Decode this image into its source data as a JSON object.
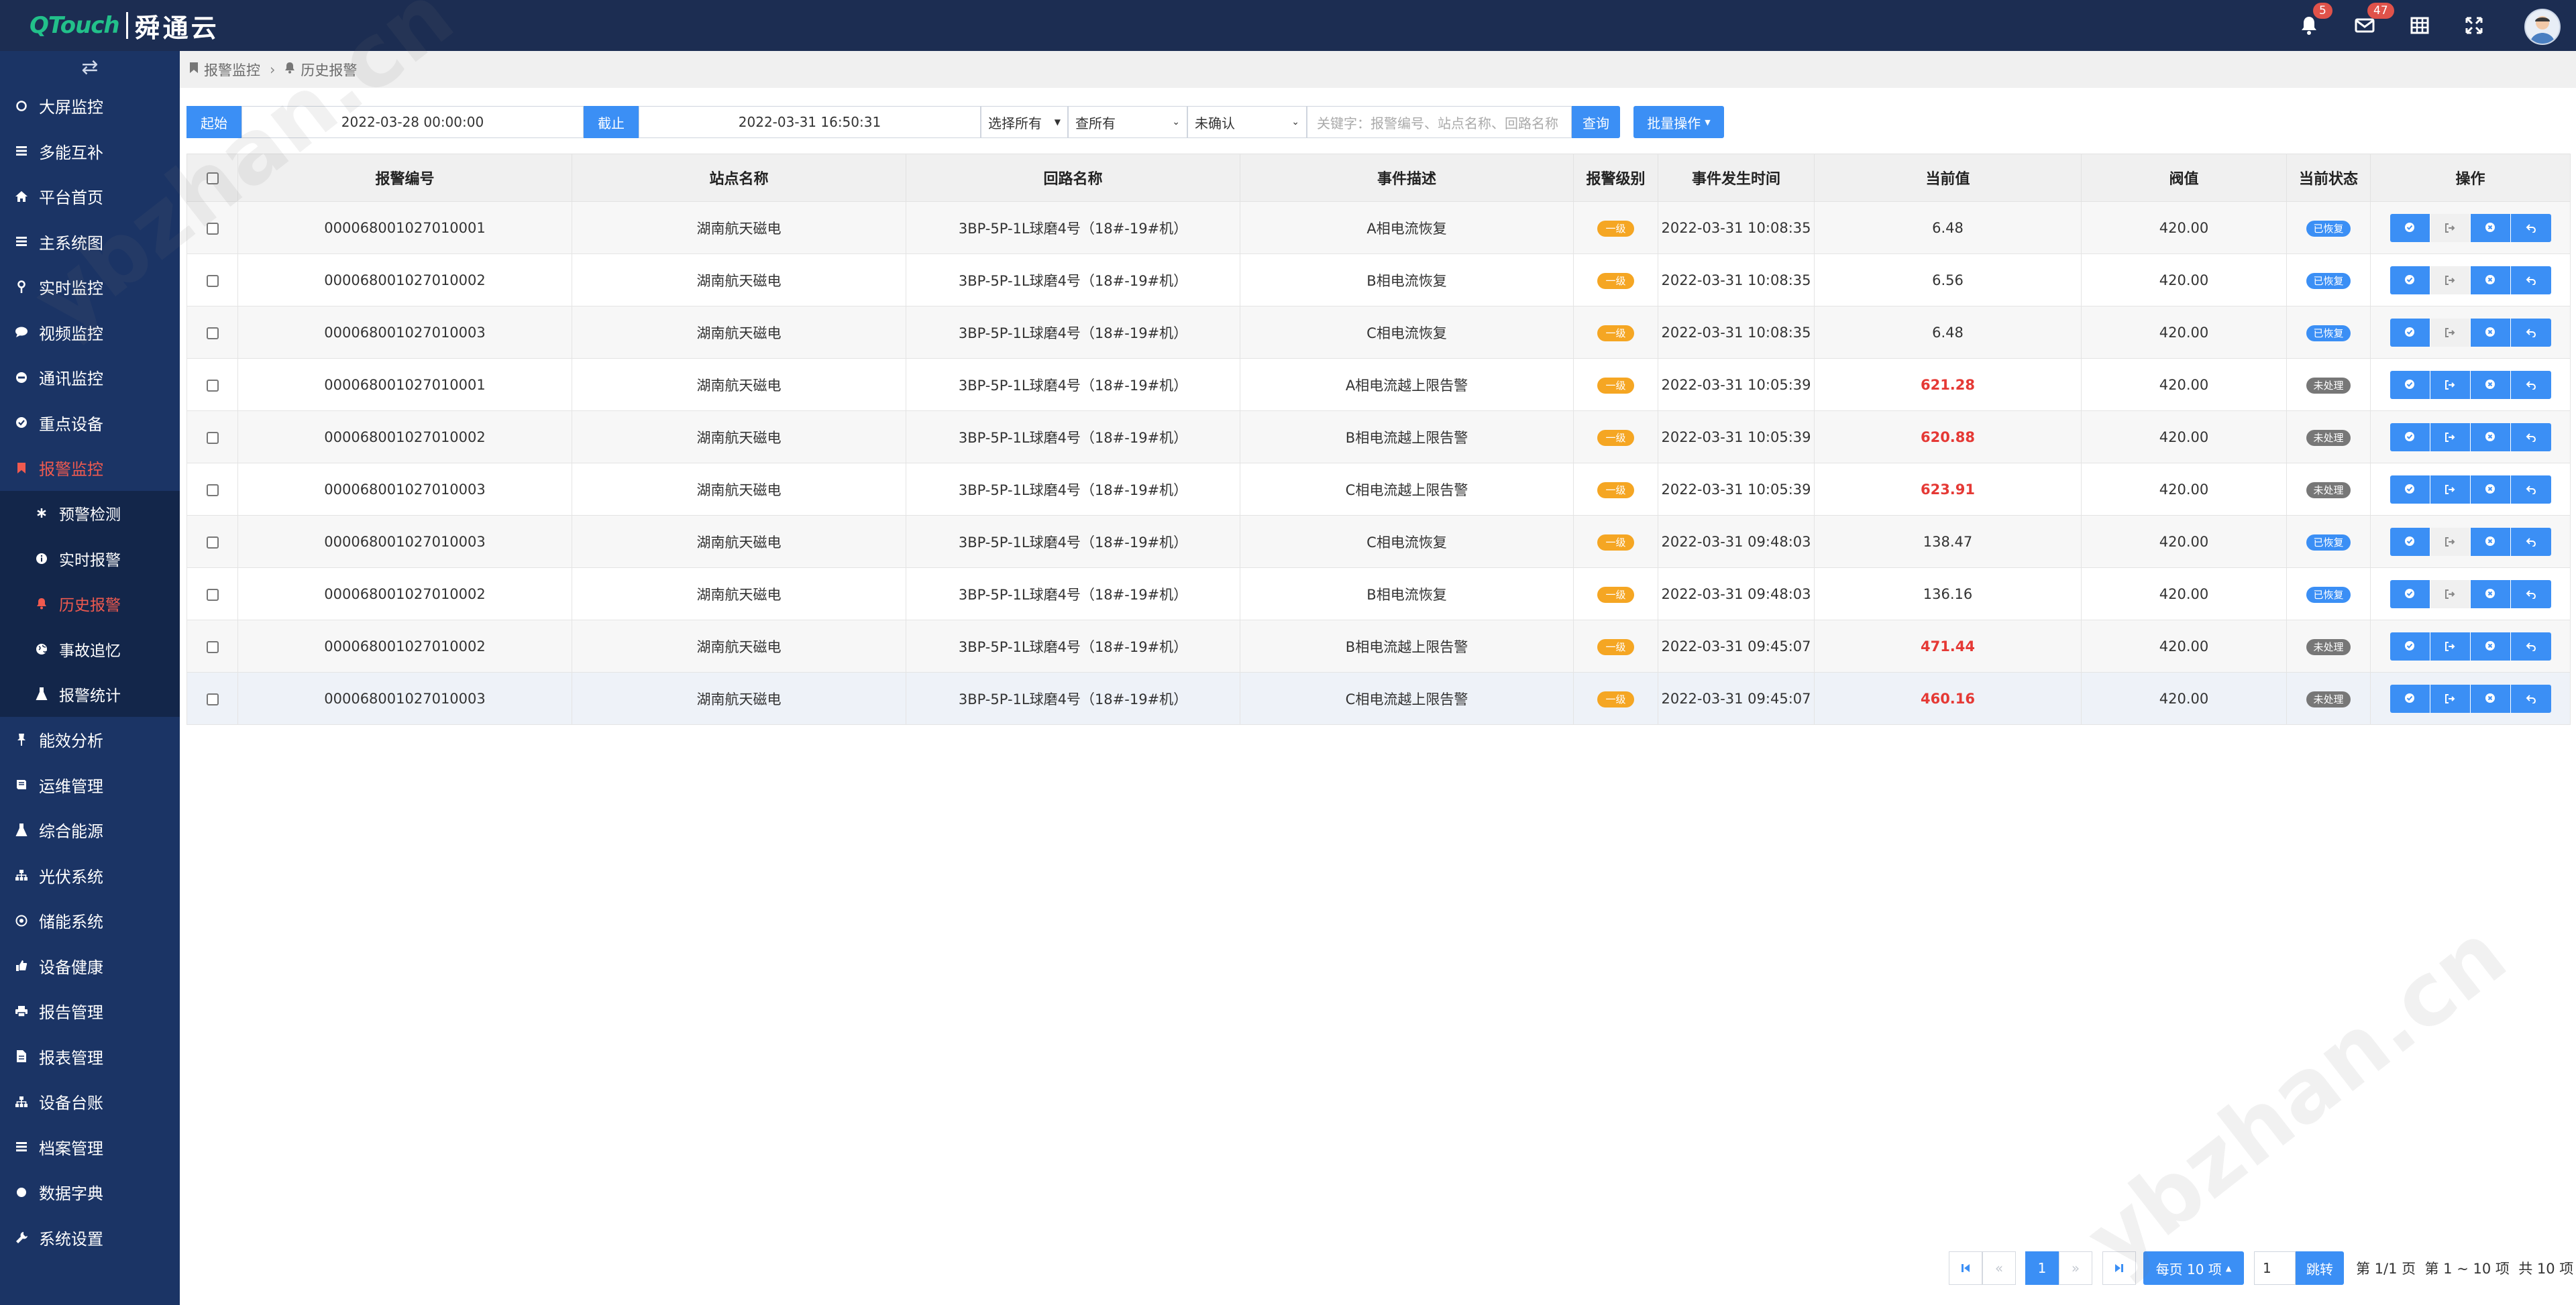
{
  "brand": {
    "logo_en": "QTouch",
    "logo_cn": "舜通云"
  },
  "topbar": {
    "notifications_badge": "5",
    "messages_badge": "47"
  },
  "sidebar": {
    "items": [
      {
        "label": "大屏监控",
        "icon": "circle-outline-icon"
      },
      {
        "label": "多能互补",
        "icon": "list-icon"
      },
      {
        "label": "平台首页",
        "icon": "home-icon"
      },
      {
        "label": "主系统图",
        "icon": "list-icon"
      },
      {
        "label": "实时监控",
        "icon": "map-pin-icon"
      },
      {
        "label": "视频监控",
        "icon": "chat-icon"
      },
      {
        "label": "通讯监控",
        "icon": "no-entry-icon"
      },
      {
        "label": "重点设备",
        "icon": "check-circle-icon"
      },
      {
        "label": "报警监控",
        "icon": "bookmark-icon"
      },
      {
        "label": "能效分析",
        "icon": "pushpin-icon"
      },
      {
        "label": "运维管理",
        "icon": "book-icon"
      },
      {
        "label": "综合能源",
        "icon": "flask-icon"
      },
      {
        "label": "光伏系统",
        "icon": "sitemap-icon"
      },
      {
        "label": "储能系统",
        "icon": "target-icon"
      },
      {
        "label": "设备健康",
        "icon": "thumbs-up-icon"
      },
      {
        "label": "报告管理",
        "icon": "printer-icon"
      },
      {
        "label": "报表管理",
        "icon": "file-icon"
      },
      {
        "label": "设备台账",
        "icon": "sitemap-icon"
      },
      {
        "label": "档案管理",
        "icon": "list-icon"
      },
      {
        "label": "数据字典",
        "icon": "circle-icon"
      },
      {
        "label": "系统设置",
        "icon": "wrench-icon"
      }
    ],
    "alarm_sub": [
      {
        "label": "预警检测",
        "icon": "asterisk-icon"
      },
      {
        "label": "实时报警",
        "icon": "info-circle-icon"
      },
      {
        "label": "历史报警",
        "icon": "bell-icon"
      },
      {
        "label": "事故追忆",
        "icon": "globe-icon"
      },
      {
        "label": "报警统计",
        "icon": "flask-icon"
      }
    ]
  },
  "breadcrumb": {
    "parent": "报警监控",
    "current": "历史报警"
  },
  "filters": {
    "start_label": "起始",
    "start_value": "2022-03-28 00:00:00",
    "end_label": "截止",
    "end_value": "2022-03-31 16:50:31",
    "select_all": "选择所有",
    "query_all": "查所有",
    "confirm_state": "未确认",
    "keyword_placeholder": "关键字：报警编号、站点名称、回路名称",
    "search_btn": "查询",
    "batch_btn": "批量操作"
  },
  "table": {
    "headers": [
      "报警编号",
      "站点名称",
      "回路名称",
      "事件描述",
      "报警级别",
      "事件发生时间",
      "当前值",
      "阀值",
      "当前状态",
      "操作"
    ],
    "rows": [
      {
        "id": "000068001027010001",
        "site": "湖南航天磁电",
        "loop": "3BP-5P-1L球磨4号（18#-19#机）",
        "desc": "A相电流恢复",
        "level": "一级",
        "time": "2022-03-31 10:08:35",
        "value": "6.48",
        "alarm": false,
        "threshold": "420.00",
        "status": "已恢复",
        "recovered": true
      },
      {
        "id": "000068001027010002",
        "site": "湖南航天磁电",
        "loop": "3BP-5P-1L球磨4号（18#-19#机）",
        "desc": "B相电流恢复",
        "level": "一级",
        "time": "2022-03-31 10:08:35",
        "value": "6.56",
        "alarm": false,
        "threshold": "420.00",
        "status": "已恢复",
        "recovered": true
      },
      {
        "id": "000068001027010003",
        "site": "湖南航天磁电",
        "loop": "3BP-5P-1L球磨4号（18#-19#机）",
        "desc": "C相电流恢复",
        "level": "一级",
        "time": "2022-03-31 10:08:35",
        "value": "6.48",
        "alarm": false,
        "threshold": "420.00",
        "status": "已恢复",
        "recovered": true
      },
      {
        "id": "000068001027010001",
        "site": "湖南航天磁电",
        "loop": "3BP-5P-1L球磨4号（18#-19#机）",
        "desc": "A相电流越上限告警",
        "level": "一级",
        "time": "2022-03-31 10:05:39",
        "value": "621.28",
        "alarm": true,
        "threshold": "420.00",
        "status": "未处理",
        "recovered": false
      },
      {
        "id": "000068001027010002",
        "site": "湖南航天磁电",
        "loop": "3BP-5P-1L球磨4号（18#-19#机）",
        "desc": "B相电流越上限告警",
        "level": "一级",
        "time": "2022-03-31 10:05:39",
        "value": "620.88",
        "alarm": true,
        "threshold": "420.00",
        "status": "未处理",
        "recovered": false
      },
      {
        "id": "000068001027010003",
        "site": "湖南航天磁电",
        "loop": "3BP-5P-1L球磨4号（18#-19#机）",
        "desc": "C相电流越上限告警",
        "level": "一级",
        "time": "2022-03-31 10:05:39",
        "value": "623.91",
        "alarm": true,
        "threshold": "420.00",
        "status": "未处理",
        "recovered": false
      },
      {
        "id": "000068001027010003",
        "site": "湖南航天磁电",
        "loop": "3BP-5P-1L球磨4号（18#-19#机）",
        "desc": "C相电流恢复",
        "level": "一级",
        "time": "2022-03-31 09:48:03",
        "value": "138.47",
        "alarm": false,
        "threshold": "420.00",
        "status": "已恢复",
        "recovered": true
      },
      {
        "id": "000068001027010002",
        "site": "湖南航天磁电",
        "loop": "3BP-5P-1L球磨4号（18#-19#机）",
        "desc": "B相电流恢复",
        "level": "一级",
        "time": "2022-03-31 09:48:03",
        "value": "136.16",
        "alarm": false,
        "threshold": "420.00",
        "status": "已恢复",
        "recovered": true
      },
      {
        "id": "000068001027010002",
        "site": "湖南航天磁电",
        "loop": "3BP-5P-1L球磨4号（18#-19#机）",
        "desc": "B相电流越上限告警",
        "level": "一级",
        "time": "2022-03-31 09:45:07",
        "value": "471.44",
        "alarm": true,
        "threshold": "420.00",
        "status": "未处理",
        "recovered": false
      },
      {
        "id": "000068001027010003",
        "site": "湖南航天磁电",
        "loop": "3BP-5P-1L球磨4号（18#-19#机）",
        "desc": "C相电流越上限告警",
        "level": "一级",
        "time": "2022-03-31 09:45:07",
        "value": "460.16",
        "alarm": true,
        "threshold": "420.00",
        "status": "未处理",
        "recovered": false
      }
    ]
  },
  "pagination": {
    "current_page": "1",
    "page_size_label": "每页 10 项",
    "goto_value": "1",
    "goto_btn": "跳转",
    "info": "第 1/1 页  第 1 ~ 10 项  共 10 项"
  },
  "watermark": "ybzhan.cn",
  "colors": {
    "topbar": "#1c2d52",
    "sidebar": "#1b3465",
    "accent": "#3b8ff5",
    "active_menu": "#f05a4f",
    "alarm_value": "#e53935",
    "level_badge": "#f5a623"
  }
}
